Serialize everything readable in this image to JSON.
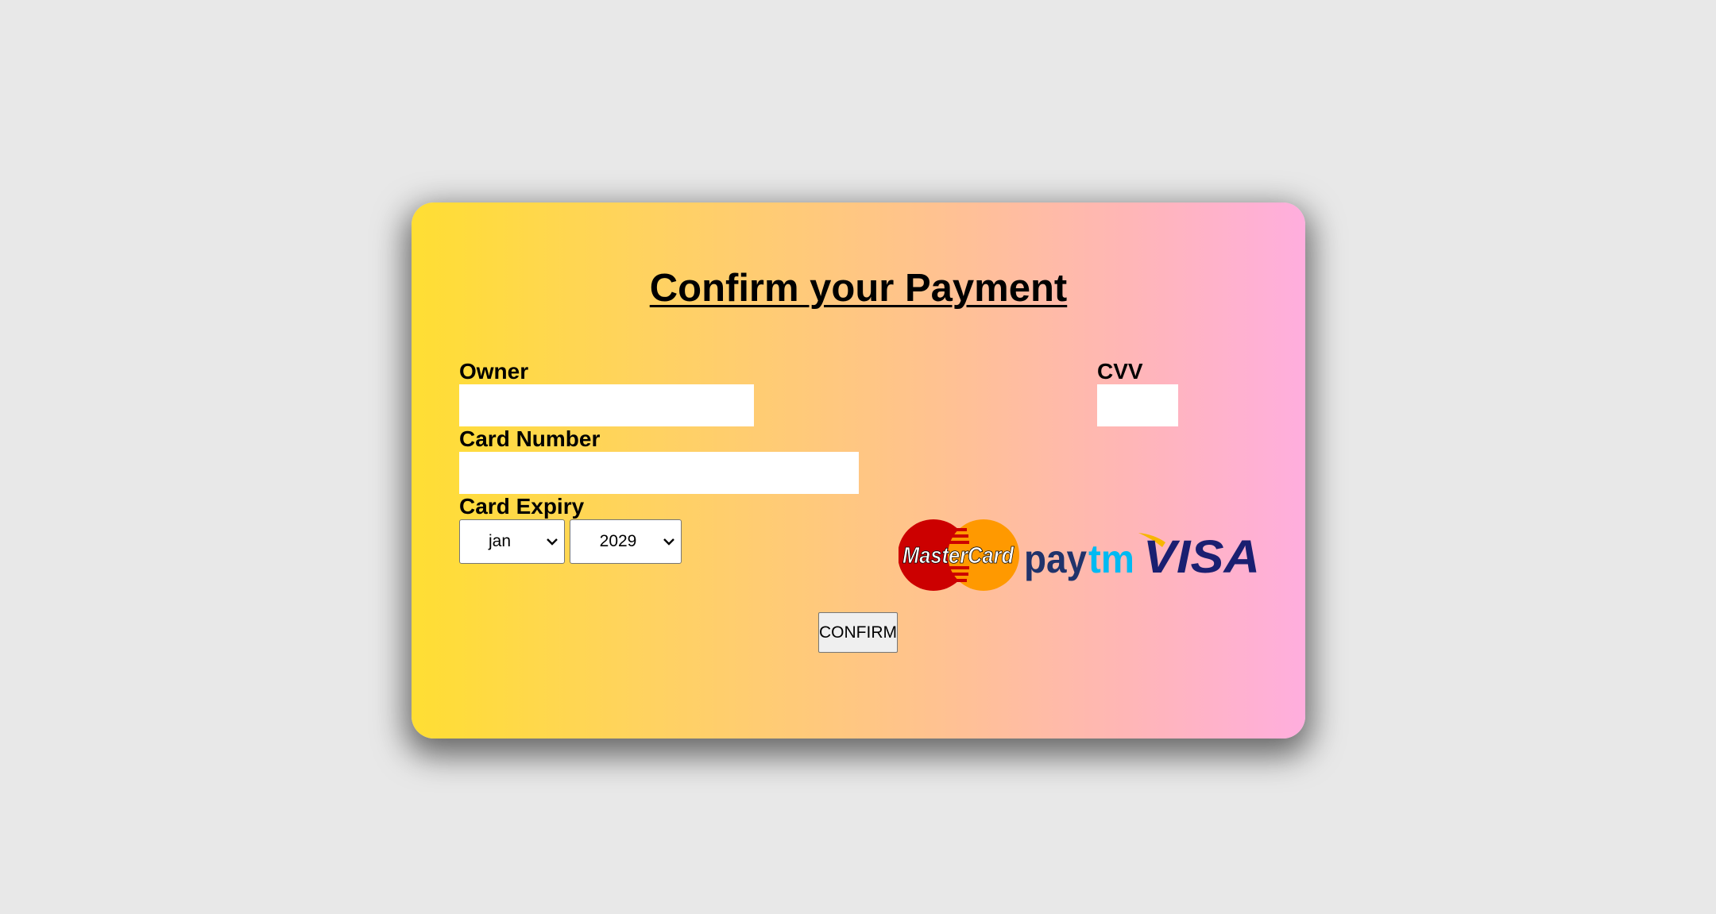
{
  "form": {
    "title": "Confirm your Payment",
    "owner_label": "Owner",
    "owner_value": "",
    "cvv_label": "CVV",
    "cvv_value": "",
    "card_number_label": "Card Number",
    "card_number_value": "",
    "expiry_label": "Card Expiry",
    "expiry_month": "jan",
    "expiry_year": "2029",
    "confirm_label": "CONFIRM"
  },
  "logos": {
    "mastercard": "MasterCard",
    "paytm_pay": "pay",
    "paytm_tm": "tm",
    "visa": "VISA"
  },
  "colors": {
    "background": "#e8e8e8",
    "card_gradient_start": "#ffde33",
    "card_gradient_end": "#ffaede",
    "mastercard_red": "#cc0000",
    "mastercard_orange": "#ff9900",
    "paytm_navy": "#20336b",
    "paytm_blue": "#00baf2",
    "visa_blue": "#1a1f71",
    "visa_gold": "#f7b600"
  }
}
